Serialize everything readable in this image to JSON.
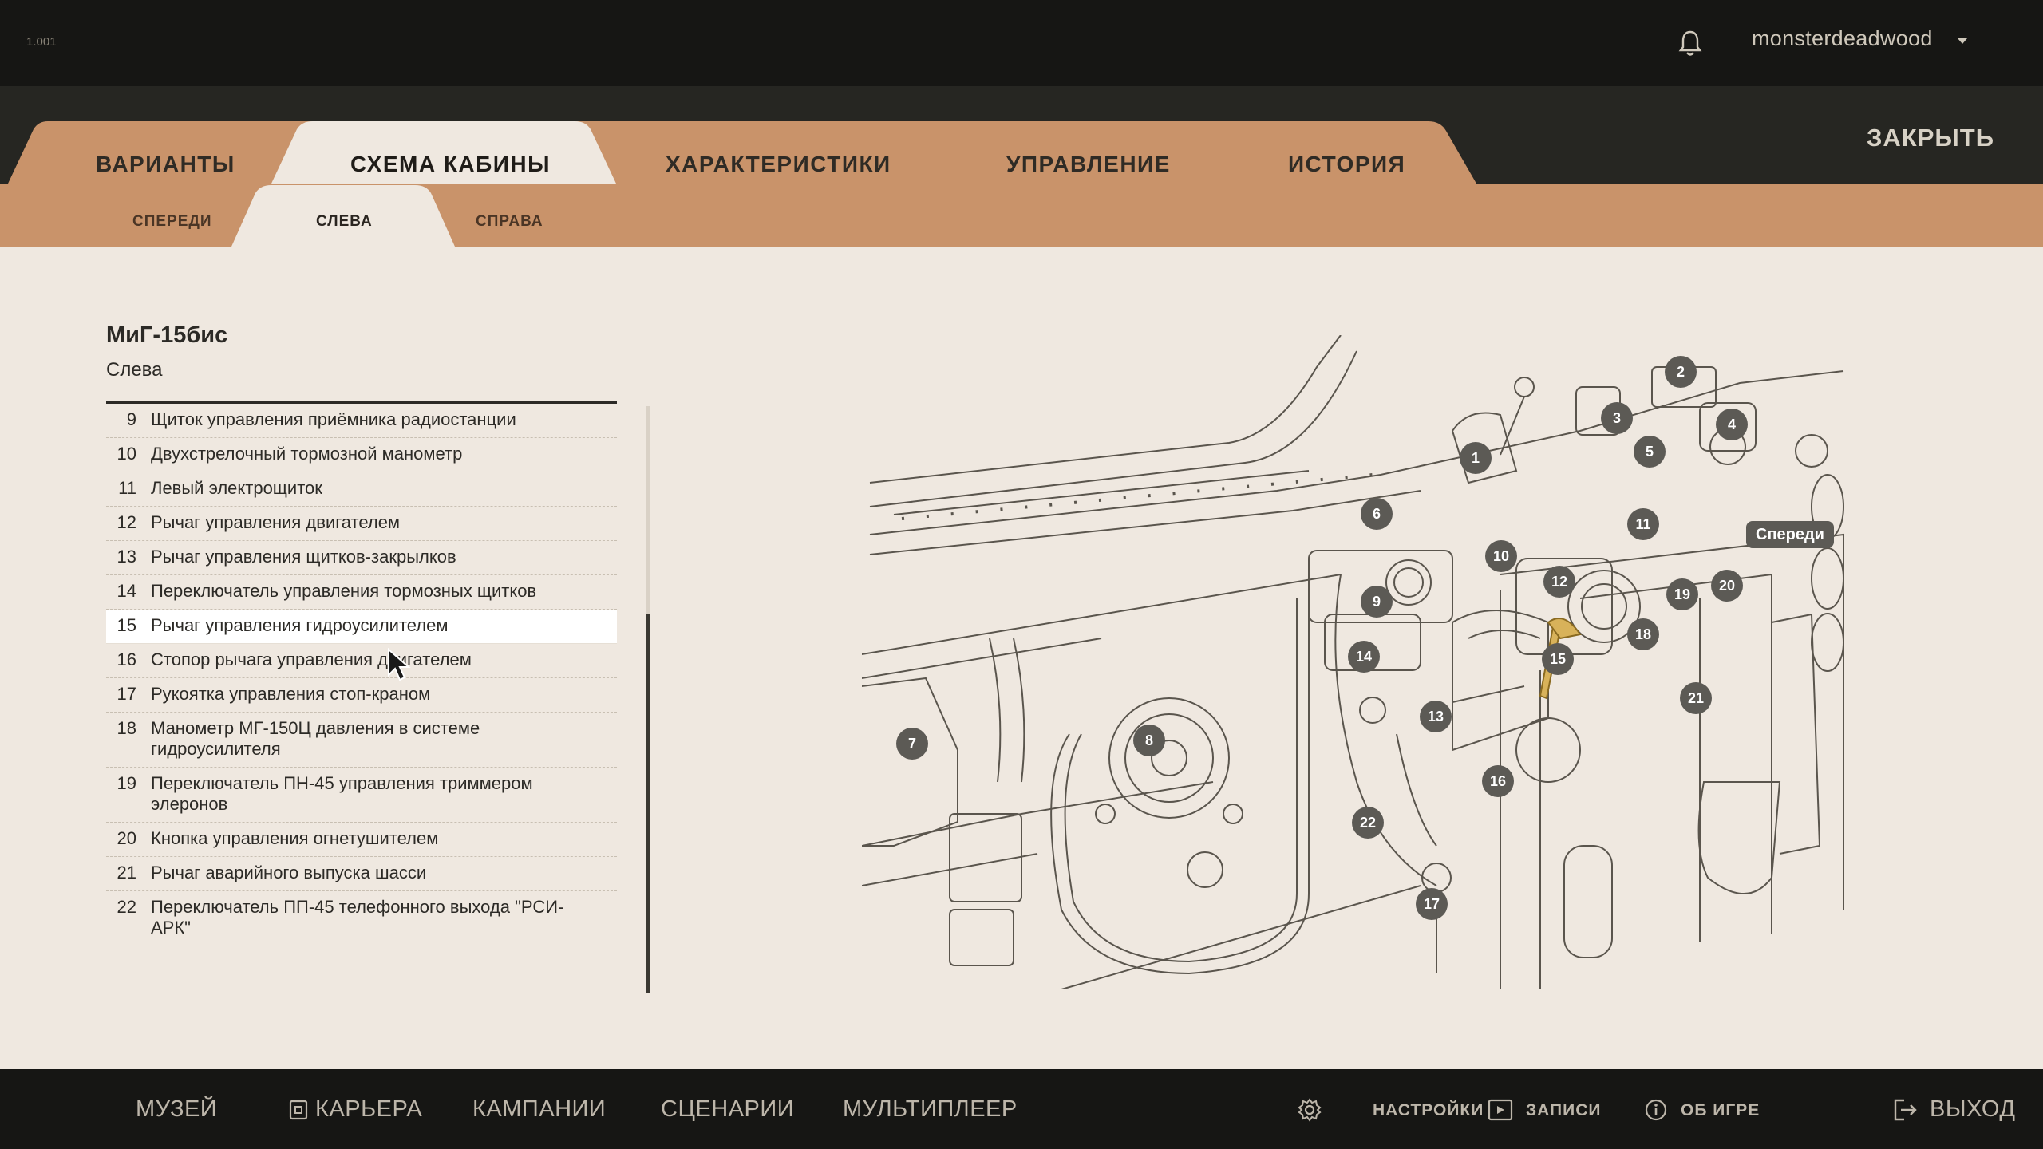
{
  "app": {
    "version": "1.001",
    "user": "monsterdeadwood"
  },
  "main_tabs": [
    {
      "label": "ВАРИАНТЫ"
    },
    {
      "label": "СХЕМА КАБИНЫ"
    },
    {
      "label": "ХАРАКТЕРИСТИКИ"
    },
    {
      "label": "УПРАВЛЕНИЕ"
    },
    {
      "label": "ИСТОРИЯ"
    }
  ],
  "active_main_tab": "СХЕМА КАБИНЫ",
  "close_label": "ЗАКРЫТЬ",
  "sub_tabs": [
    {
      "label": "СПЕРЕДИ"
    },
    {
      "label": "СЛЕВА"
    },
    {
      "label": "СПРАВА"
    }
  ],
  "active_sub_tab": "СЛЕВА",
  "aircraft": {
    "title": "МиГ-15бис",
    "view": "Слева"
  },
  "parts": [
    {
      "num": "9",
      "label": "Щиток управления приёмника радиостанции"
    },
    {
      "num": "10",
      "label": "Двухстрелочный тормозной манометр"
    },
    {
      "num": "11",
      "label": "Левый электрощиток"
    },
    {
      "num": "12",
      "label": "Рычаг управления двигателем"
    },
    {
      "num": "13",
      "label": "Рычаг управления щитков-закрылков"
    },
    {
      "num": "14",
      "label": "Переключатель управления тормозных щитков"
    },
    {
      "num": "15",
      "label": "Рычаг управления гидроусилителем"
    },
    {
      "num": "16",
      "label": "Стопор рычага управления двигателем"
    },
    {
      "num": "17",
      "label": "Рукоятка управления стоп-краном"
    },
    {
      "num": "18",
      "label": "Манометр МГ-150Ц давления в системе гидроусилителя"
    },
    {
      "num": "19",
      "label": "Переключатель ПН-45 управления триммером элеронов"
    },
    {
      "num": "20",
      "label": "Кнопка управления огнетушителем"
    },
    {
      "num": "21",
      "label": "Рычаг аварийного выпуска шасси"
    },
    {
      "num": "22",
      "label": "Переключатель ПП-45 телефонного выхода \"РСИ-АРК\""
    }
  ],
  "active_part": "15",
  "diagram": {
    "markers": [
      "1",
      "2",
      "3",
      "4",
      "5",
      "6",
      "7",
      "8",
      "9",
      "10",
      "11",
      "12",
      "13",
      "14",
      "15",
      "16",
      "17",
      "18",
      "19",
      "20",
      "21",
      "22"
    ],
    "nav_label": "Спереди"
  },
  "bottom_nav": {
    "museum": "МУЗЕЙ",
    "career": "КАРЬЕРА",
    "campaigns": "КАМПАНИИ",
    "scenarios": "СЦЕНАРИИ",
    "multiplayer": "МУЛЬТИПЛЕЕР",
    "settings": "НАСТРОЙКИ",
    "records": "ЗАПИСИ",
    "about": "ОБ ИГРЕ",
    "exit": "ВЫХОД"
  },
  "colors": {
    "tab_tan": "#c9936a",
    "active_tab": "#efe8e0",
    "dark_bar": "#161614",
    "highlight_part": "#d8b25a"
  }
}
